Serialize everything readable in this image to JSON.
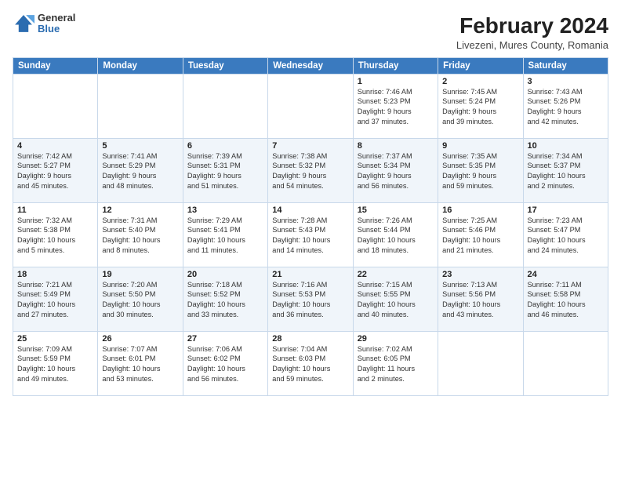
{
  "logo": {
    "general": "General",
    "blue": "Blue"
  },
  "header": {
    "title": "February 2024",
    "subtitle": "Livezeni, Mures County, Romania"
  },
  "weekdays": [
    "Sunday",
    "Monday",
    "Tuesday",
    "Wednesday",
    "Thursday",
    "Friday",
    "Saturday"
  ],
  "weeks": [
    [
      {
        "day": "",
        "info": ""
      },
      {
        "day": "",
        "info": ""
      },
      {
        "day": "",
        "info": ""
      },
      {
        "day": "",
        "info": ""
      },
      {
        "day": "1",
        "info": "Sunrise: 7:46 AM\nSunset: 5:23 PM\nDaylight: 9 hours\nand 37 minutes."
      },
      {
        "day": "2",
        "info": "Sunrise: 7:45 AM\nSunset: 5:24 PM\nDaylight: 9 hours\nand 39 minutes."
      },
      {
        "day": "3",
        "info": "Sunrise: 7:43 AM\nSunset: 5:26 PM\nDaylight: 9 hours\nand 42 minutes."
      }
    ],
    [
      {
        "day": "4",
        "info": "Sunrise: 7:42 AM\nSunset: 5:27 PM\nDaylight: 9 hours\nand 45 minutes."
      },
      {
        "day": "5",
        "info": "Sunrise: 7:41 AM\nSunset: 5:29 PM\nDaylight: 9 hours\nand 48 minutes."
      },
      {
        "day": "6",
        "info": "Sunrise: 7:39 AM\nSunset: 5:31 PM\nDaylight: 9 hours\nand 51 minutes."
      },
      {
        "day": "7",
        "info": "Sunrise: 7:38 AM\nSunset: 5:32 PM\nDaylight: 9 hours\nand 54 minutes."
      },
      {
        "day": "8",
        "info": "Sunrise: 7:37 AM\nSunset: 5:34 PM\nDaylight: 9 hours\nand 56 minutes."
      },
      {
        "day": "9",
        "info": "Sunrise: 7:35 AM\nSunset: 5:35 PM\nDaylight: 9 hours\nand 59 minutes."
      },
      {
        "day": "10",
        "info": "Sunrise: 7:34 AM\nSunset: 5:37 PM\nDaylight: 10 hours\nand 2 minutes."
      }
    ],
    [
      {
        "day": "11",
        "info": "Sunrise: 7:32 AM\nSunset: 5:38 PM\nDaylight: 10 hours\nand 5 minutes."
      },
      {
        "day": "12",
        "info": "Sunrise: 7:31 AM\nSunset: 5:40 PM\nDaylight: 10 hours\nand 8 minutes."
      },
      {
        "day": "13",
        "info": "Sunrise: 7:29 AM\nSunset: 5:41 PM\nDaylight: 10 hours\nand 11 minutes."
      },
      {
        "day": "14",
        "info": "Sunrise: 7:28 AM\nSunset: 5:43 PM\nDaylight: 10 hours\nand 14 minutes."
      },
      {
        "day": "15",
        "info": "Sunrise: 7:26 AM\nSunset: 5:44 PM\nDaylight: 10 hours\nand 18 minutes."
      },
      {
        "day": "16",
        "info": "Sunrise: 7:25 AM\nSunset: 5:46 PM\nDaylight: 10 hours\nand 21 minutes."
      },
      {
        "day": "17",
        "info": "Sunrise: 7:23 AM\nSunset: 5:47 PM\nDaylight: 10 hours\nand 24 minutes."
      }
    ],
    [
      {
        "day": "18",
        "info": "Sunrise: 7:21 AM\nSunset: 5:49 PM\nDaylight: 10 hours\nand 27 minutes."
      },
      {
        "day": "19",
        "info": "Sunrise: 7:20 AM\nSunset: 5:50 PM\nDaylight: 10 hours\nand 30 minutes."
      },
      {
        "day": "20",
        "info": "Sunrise: 7:18 AM\nSunset: 5:52 PM\nDaylight: 10 hours\nand 33 minutes."
      },
      {
        "day": "21",
        "info": "Sunrise: 7:16 AM\nSunset: 5:53 PM\nDaylight: 10 hours\nand 36 minutes."
      },
      {
        "day": "22",
        "info": "Sunrise: 7:15 AM\nSunset: 5:55 PM\nDaylight: 10 hours\nand 40 minutes."
      },
      {
        "day": "23",
        "info": "Sunrise: 7:13 AM\nSunset: 5:56 PM\nDaylight: 10 hours\nand 43 minutes."
      },
      {
        "day": "24",
        "info": "Sunrise: 7:11 AM\nSunset: 5:58 PM\nDaylight: 10 hours\nand 46 minutes."
      }
    ],
    [
      {
        "day": "25",
        "info": "Sunrise: 7:09 AM\nSunset: 5:59 PM\nDaylight: 10 hours\nand 49 minutes."
      },
      {
        "day": "26",
        "info": "Sunrise: 7:07 AM\nSunset: 6:01 PM\nDaylight: 10 hours\nand 53 minutes."
      },
      {
        "day": "27",
        "info": "Sunrise: 7:06 AM\nSunset: 6:02 PM\nDaylight: 10 hours\nand 56 minutes."
      },
      {
        "day": "28",
        "info": "Sunrise: 7:04 AM\nSunset: 6:03 PM\nDaylight: 10 hours\nand 59 minutes."
      },
      {
        "day": "29",
        "info": "Sunrise: 7:02 AM\nSunset: 6:05 PM\nDaylight: 11 hours\nand 2 minutes."
      },
      {
        "day": "",
        "info": ""
      },
      {
        "day": "",
        "info": ""
      }
    ]
  ]
}
